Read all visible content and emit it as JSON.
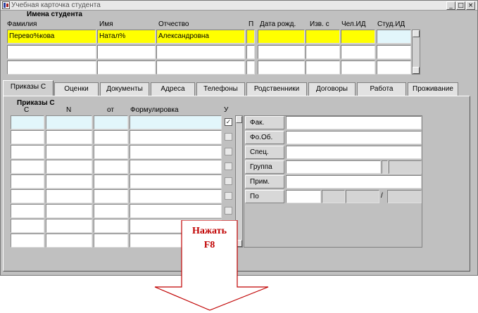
{
  "window": {
    "title": "Учебная карточка студента",
    "buttons": [
      "_",
      "□",
      "×"
    ]
  },
  "student_names": {
    "section_title": "Имена студента",
    "columns": [
      "Фамилия",
      "Имя",
      "Отчество",
      "П",
      "Дата рожд.",
      "Изв. с",
      "Чел.ИД",
      "Студ.ИД"
    ],
    "rows": [
      [
        "Перево%кова",
        "Натал%",
        "Александровна",
        "",
        "",
        "",
        "",
        ""
      ],
      [
        "",
        "",
        "",
        "",
        "",
        "",
        "",
        ""
      ],
      [
        "",
        "",
        "",
        "",
        "",
        "",
        "",
        ""
      ]
    ]
  },
  "tabs": [
    {
      "label": "Приказы С",
      "active": true
    },
    {
      "label": "Оценки",
      "active": false
    },
    {
      "label": "Документы",
      "active": false
    },
    {
      "label": "Адреса",
      "active": false
    },
    {
      "label": "Телефоны",
      "active": false
    },
    {
      "label": "Родственники",
      "active": false
    },
    {
      "label": "Договоры",
      "active": false
    },
    {
      "label": "Работа",
      "active": false
    },
    {
      "label": "Проживание",
      "active": false
    }
  ],
  "orders": {
    "section_title": "Приказы С",
    "columns": [
      "С",
      "N",
      "от",
      "Формулировка",
      "У"
    ],
    "row_count": 9,
    "checked_rows": [
      0
    ]
  },
  "details": {
    "labels": [
      "Фак.",
      "Фо.Об.",
      "Спец.",
      "Группа",
      "Прим.",
      "По"
    ],
    "separator": "/"
  },
  "callout": {
    "line1": "Нажать",
    "line2": "F8"
  },
  "colors": {
    "highlight": "#ffff00",
    "current_cell": "#e2f6fb",
    "callout_red": "#c00000"
  }
}
